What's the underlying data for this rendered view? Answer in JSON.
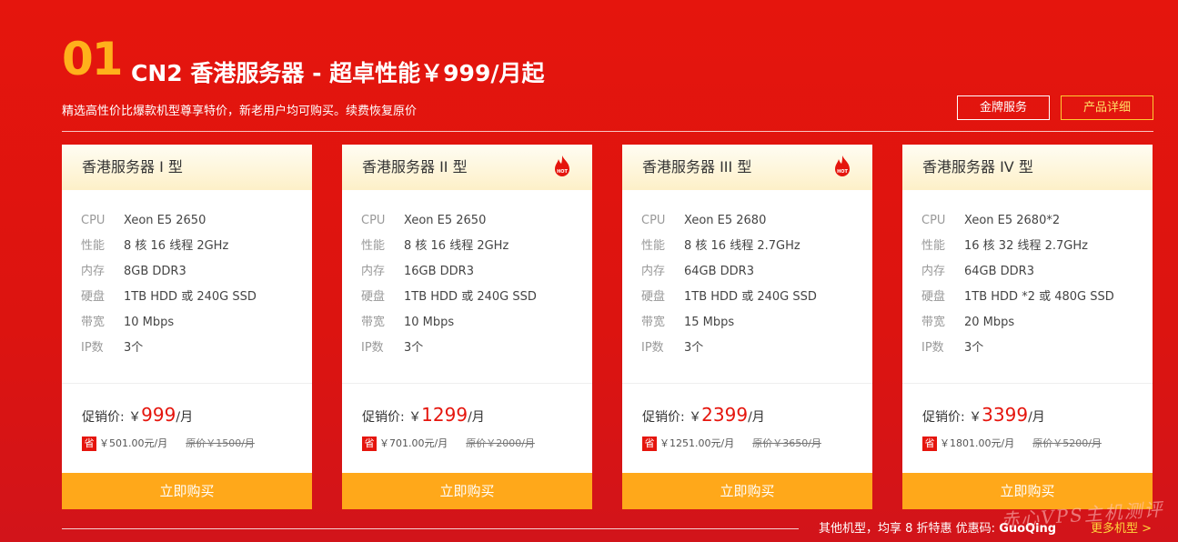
{
  "header": {
    "number": "01",
    "title": "CN2 香港服务器 - 超卓性能￥999/月起",
    "subtitle": "精选高性价比爆款机型尊享特价，新老用户均可购买。续费恢复原价",
    "btn_gold_service": "金牌服务",
    "btn_product_detail": "产品详细"
  },
  "colors": {
    "background": "#e5150d",
    "accent": "#ffa81a",
    "price": "#e5150d"
  },
  "spec_labels": {
    "cpu": "CPU",
    "perf": "性能",
    "mem": "内存",
    "disk": "硬盘",
    "bw": "带宽",
    "ip": "IP数"
  },
  "price_label": "促销价: ￥",
  "per_month": "/月",
  "save_badge": "省",
  "buy_label": "立即购买",
  "cards": [
    {
      "name": "香港服务器 I 型",
      "hot": false,
      "cpu": "Xeon E5 2650",
      "perf": "8 核 16 线程 2GHz",
      "mem": "8GB DDR3",
      "disk": "1TB HDD 或 240G SSD",
      "bw": "10 Mbps",
      "ip": "3个",
      "price": "999",
      "save": "￥501.00元/月",
      "orig": "原价￥1500/月"
    },
    {
      "name": "香港服务器 II 型",
      "hot": true,
      "cpu": "Xeon E5 2650",
      "perf": "8 核 16 线程 2GHz",
      "mem": "16GB DDR3",
      "disk": "1TB HDD 或 240G SSD",
      "bw": "10 Mbps",
      "ip": "3个",
      "price": "1299",
      "save": "￥701.00元/月",
      "orig": "原价￥2000/月"
    },
    {
      "name": "香港服务器 III 型",
      "hot": true,
      "cpu": "Xeon E5 2680",
      "perf": "8 核 16 线程 2.7GHz",
      "mem": "64GB DDR3",
      "disk": "1TB HDD 或 240G SSD",
      "bw": "15 Mbps",
      "ip": "3个",
      "price": "2399",
      "save": "￥1251.00元/月",
      "orig": "原价￥3650/月"
    },
    {
      "name": "香港服务器 IV 型",
      "hot": false,
      "cpu": "Xeon E5 2680*2",
      "perf": "16 核 32 线程 2.7GHz",
      "mem": "64GB DDR3",
      "disk": "1TB HDD *2 或 480G SSD",
      "bw": "20 Mbps",
      "ip": "3个",
      "price": "3399",
      "save": "￥1801.00元/月",
      "orig": "原价￥5200/月"
    }
  ],
  "hot_icon": "hot-flame-icon",
  "hot_text": "HOT",
  "footer": {
    "text": "其他机型，均享 8 折特惠 优惠码: ",
    "code": "GuoQing",
    "more": "更多机型 >",
    "watermark": "赤心VPS主机测评"
  }
}
